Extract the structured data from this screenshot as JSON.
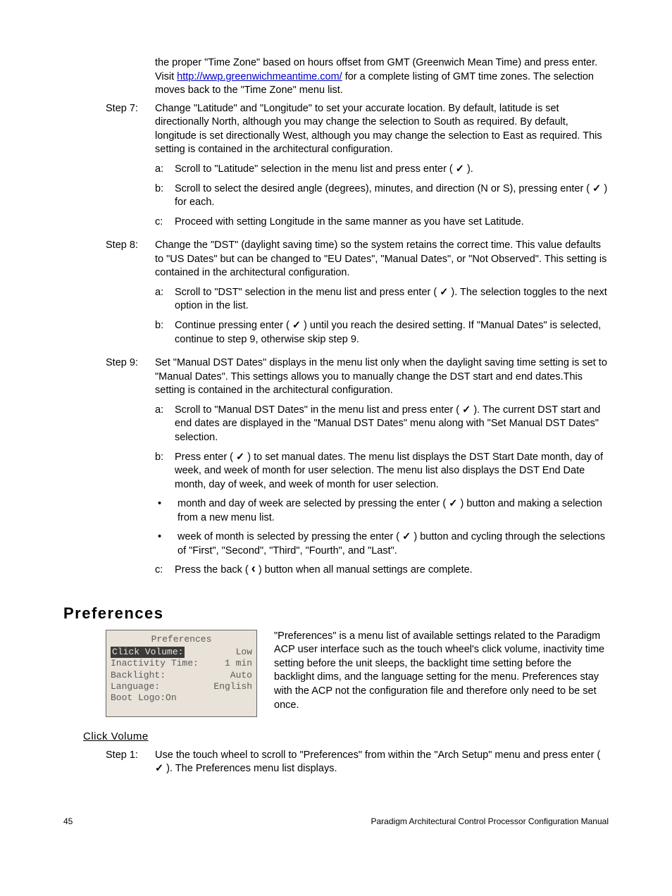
{
  "intro": {
    "pre": "the proper \"Time Zone\" based on hours offset from GMT (Greenwich Mean Time) and press enter. Visit ",
    "link": "http://wwp.greenwichmeantime.com/",
    "post": " for a complete listing of GMT time zones. The selection moves back to the \"Time Zone\" menu list."
  },
  "step7": {
    "label": "Step 7:",
    "body": "Change \"Latitude\" and \"Longitude\" to set your accurate location. By default, latitude is set directionally North, although you may change the selection to South as required. By default, longitude is set directionally West, although you may change the selection to East as required. This setting is contained in the architectural configuration.",
    "a_label": "a:",
    "a_pre": "Scroll to \"Latitude\" selection in the menu list and press enter ( ",
    "a_post": " ).",
    "b_label": "b:",
    "b_pre": "Scroll to select the desired angle (degrees), minutes, and direction (N or S), pressing enter ( ",
    "b_post": " ) for each.",
    "c_label": "c:",
    "c": "Proceed with setting Longitude in the same manner as you have set Latitude."
  },
  "step8": {
    "label": "Step 8:",
    "body": "Change the \"DST\" (daylight saving time) so the system retains the correct time. This value defaults to \"US Dates\" but can be changed to \"EU Dates\", \"Manual Dates\", or \"Not Observed\". This setting is contained in the architectural configuration.",
    "a_label": "a:",
    "a_pre": "Scroll to \"DST\" selection in the menu list and press enter ( ",
    "a_post": " ). The selection toggles to the next option in the list.",
    "b_label": "b:",
    "b_pre": "Continue pressing enter ( ",
    "b_post": " ) until you reach the desired setting. If \"Manual Dates\" is selected, continue to step 9, otherwise skip step 9."
  },
  "step9": {
    "label": "Step 9:",
    "body": "Set \"Manual DST Dates\" displays in the menu list only when the daylight saving time setting is set to \"Manual Dates\". This settings allows you to manually change the DST start and end dates.This setting is contained in the architectural configuration.",
    "a_label": "a:",
    "a_pre": "Scroll to \"Manual DST Dates\" in the menu list and press enter ( ",
    "a_post": " ). The current DST start and end dates are displayed in the \"Manual DST Dates\" menu along with \"Set Manual DST Dates\" selection.",
    "b_label": "b:",
    "b_pre": "Press enter ( ",
    "b_post": " ) to set manual dates. The menu list displays the DST Start Date month, day of week, and week of month for user selection. The menu list also displays the DST End Date month, day of week, and week of month for user selection.",
    "bullet1_pre": "month and day of week are selected by pressing the enter ( ",
    "bullet1_post": " ) button and making a selection from a new menu list.",
    "bullet2_pre": "week of month is selected by pressing the enter ( ",
    "bullet2_post": " ) button and cycling through the selections of \"First\", \"Second\", \"Third\", \"Fourth\", and \"Last\".",
    "c_label": "c:",
    "c_pre": "Press the back ( ",
    "c_post": " ) button when all manual settings are complete."
  },
  "prefs": {
    "heading": "Preferences",
    "lcd_title": "Preferences",
    "rows": [
      {
        "key": "Click Volume:",
        "val": "Low",
        "selected": true
      },
      {
        "key": "Inactivity Time:",
        "val": "1 min",
        "selected": false
      },
      {
        "key": "Backlight:",
        "val": "Auto",
        "selected": false
      },
      {
        "key": "Language:",
        "val": "English",
        "selected": false
      },
      {
        "key": "Boot Logo:On",
        "val": "",
        "selected": false
      }
    ],
    "desc": "\"Preferences\" is a menu list of available settings related to the Paradigm ACP user interface such as the touch wheel's click volume, inactivity time setting before the unit sleeps, the backlight time setting before the backlight dims, and the language setting for the menu. Preferences stay with the ACP not the configuration file and therefore only need to be set once."
  },
  "click": {
    "heading": "Click Volume",
    "step1_label": "Step 1:",
    "step1_pre": "Use the touch wheel to scroll to \"Preferences\" from within the \"Arch Setup\" menu and press enter ( ",
    "step1_post": " ). The Preferences menu list displays."
  },
  "footer": {
    "page": "45",
    "title": "Paradigm Architectural Control Processor Configuration Manual"
  }
}
